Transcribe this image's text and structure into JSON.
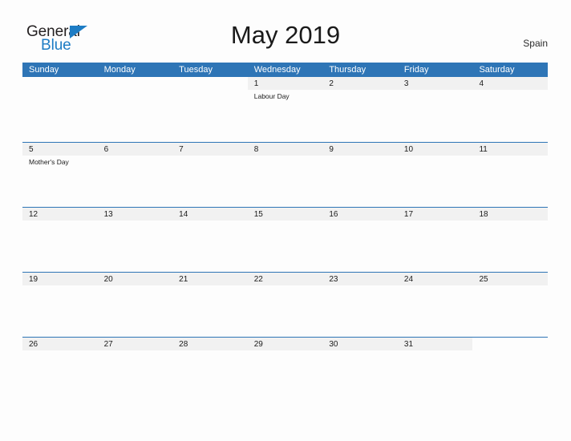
{
  "brand": {
    "name_part1": "General",
    "name_part2": "Blue",
    "triangle_icon": "triangle-icon",
    "accent_color": "#1d7cc4"
  },
  "header": {
    "title": "May 2019",
    "locale": "Spain"
  },
  "calendar": {
    "header_bg": "#2e75b6",
    "day_band_bg": "#f1f1f1",
    "weekdays": [
      "Sunday",
      "Monday",
      "Tuesday",
      "Wednesday",
      "Thursday",
      "Friday",
      "Saturday"
    ],
    "weeks": [
      [
        {
          "day": "",
          "events": []
        },
        {
          "day": "",
          "events": []
        },
        {
          "day": "",
          "events": []
        },
        {
          "day": "1",
          "events": [
            "Labour Day"
          ]
        },
        {
          "day": "2",
          "events": []
        },
        {
          "day": "3",
          "events": []
        },
        {
          "day": "4",
          "events": []
        }
      ],
      [
        {
          "day": "5",
          "events": [
            "Mother's Day"
          ]
        },
        {
          "day": "6",
          "events": []
        },
        {
          "day": "7",
          "events": []
        },
        {
          "day": "8",
          "events": []
        },
        {
          "day": "9",
          "events": []
        },
        {
          "day": "10",
          "events": []
        },
        {
          "day": "11",
          "events": []
        }
      ],
      [
        {
          "day": "12",
          "events": []
        },
        {
          "day": "13",
          "events": []
        },
        {
          "day": "14",
          "events": []
        },
        {
          "day": "15",
          "events": []
        },
        {
          "day": "16",
          "events": []
        },
        {
          "day": "17",
          "events": []
        },
        {
          "day": "18",
          "events": []
        }
      ],
      [
        {
          "day": "19",
          "events": []
        },
        {
          "day": "20",
          "events": []
        },
        {
          "day": "21",
          "events": []
        },
        {
          "day": "22",
          "events": []
        },
        {
          "day": "23",
          "events": []
        },
        {
          "day": "24",
          "events": []
        },
        {
          "day": "25",
          "events": []
        }
      ],
      [
        {
          "day": "26",
          "events": []
        },
        {
          "day": "27",
          "events": []
        },
        {
          "day": "28",
          "events": []
        },
        {
          "day": "29",
          "events": []
        },
        {
          "day": "30",
          "events": []
        },
        {
          "day": "31",
          "events": []
        },
        {
          "day": "",
          "events": []
        }
      ]
    ]
  }
}
